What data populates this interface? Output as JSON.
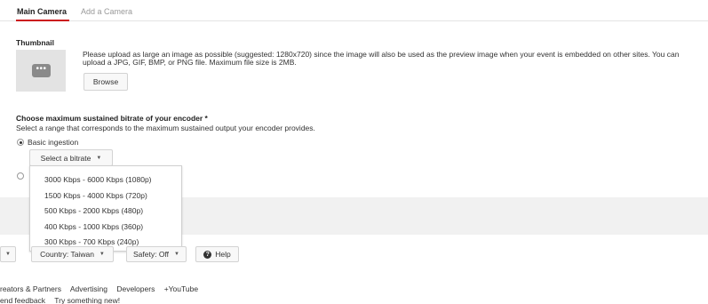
{
  "tabs": {
    "main_camera": "Main Camera",
    "add_camera": "Add a Camera"
  },
  "thumbnail": {
    "label": "Thumbnail",
    "icon_glyph": "•••",
    "description": "Please upload as large an image as possible (suggested: 1280x720) since the image will also be used as the preview image when your event is embedded on other sites. You can upload a JPG, GIF, BMP, or PNG file. Maximum file size is 2MB.",
    "browse_label": "Browse"
  },
  "bitrate": {
    "title": "Choose maximum sustained bitrate of your encoder *",
    "description": "Select a range that corresponds to the maximum sustained output your encoder provides.",
    "basic_label": "Basic ingestion",
    "select_label": "Select a bitrate",
    "options": [
      "3000 Kbps - 6000 Kbps (1080p)",
      "1500 Kbps - 4000 Kbps (720p)",
      "500 Kbps - 2000 Kbps (480p)",
      "400 Kbps - 1000 Kbps (360p)",
      "300 Kbps - 700 Kbps (240p)"
    ]
  },
  "footer": {
    "country_label": "Country: Taiwan",
    "safety_label": "Safety: Off",
    "help_label": "Help",
    "links_row1": [
      "reators & Partners",
      "Advertising",
      "Developers",
      "+YouTube"
    ],
    "links_row2": [
      "end feedback",
      "Try something new!"
    ]
  },
  "colors": {
    "accent_tab_underline": "#cc181e",
    "grey_band": "#f1f1f1"
  },
  "icons": {
    "caret": "chevron-down-icon",
    "help": "help-icon",
    "thumbnail": "image-placeholder-icon"
  }
}
